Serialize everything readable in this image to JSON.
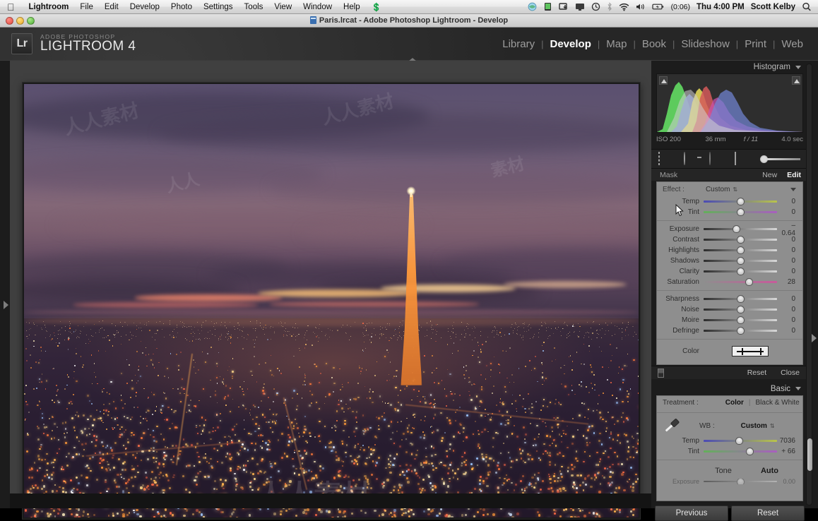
{
  "menubar": {
    "apple_icon": "apple-logo",
    "items": [
      "Lightroom",
      "File",
      "Edit",
      "Develop",
      "Photo",
      "Settings",
      "Tools",
      "View",
      "Window",
      "Help"
    ],
    "app_menu_bold": "Lightroom",
    "script_icon": "script-menu-icon",
    "status_icons": [
      "dropbox-icon",
      "display-icon",
      "eject-icon",
      "airplay-icon",
      "timemachine-icon",
      "bluetooth-icon",
      "wifi-icon",
      "volume-icon",
      "battery-icon"
    ],
    "battery_time": "(0:06)",
    "clock": "Thu 4:00 PM",
    "user": "Scott Kelby",
    "search_icon": "spotlight-search-icon"
  },
  "titlebar": {
    "title": "Paris.lrcat - Adobe Photoshop Lightroom - Develop",
    "close": "close-button",
    "minimize": "minimize-button",
    "zoom": "zoom-button"
  },
  "identity": {
    "badge": "Lr",
    "sub": "ADOBE PHOTOSHOP",
    "name": "LIGHTROOM 4"
  },
  "modules": {
    "items": [
      {
        "label": "Library",
        "active": false
      },
      {
        "label": "Develop",
        "active": true
      },
      {
        "label": "Map",
        "active": false
      },
      {
        "label": "Book",
        "active": false
      },
      {
        "label": "Slideshow",
        "active": false
      },
      {
        "label": "Print",
        "active": false
      },
      {
        "label": "Web",
        "active": false
      }
    ],
    "separator": "|"
  },
  "histogram": {
    "title": "Histogram",
    "exif": {
      "iso": "ISO 200",
      "focal": "36 mm",
      "aperture": "f / 11",
      "shutter": "4.0 sec"
    }
  },
  "tools": {
    "items": [
      "crop-overlay-tool",
      "spot-removal-tool",
      "red-eye-tool",
      "graduated-filter-tool",
      "adjustment-brush-tool"
    ],
    "selected": "adjustment-brush-tool"
  },
  "mask_row": {
    "label": "Mask",
    "new": "New",
    "edit": "Edit"
  },
  "brush_panel": {
    "effect_label": "Effect :",
    "effect_value": "Custom",
    "sliders": [
      {
        "name": "Temp",
        "value": "0",
        "pos": 50,
        "style": "tempg"
      },
      {
        "name": "Tint",
        "value": "0",
        "pos": 50,
        "style": "tintg"
      },
      {
        "name": "Exposure",
        "value": "– 0.64",
        "pos": 45,
        "style": "plain"
      },
      {
        "name": "Contrast",
        "value": "0",
        "pos": 50,
        "style": "plain"
      },
      {
        "name": "Highlights",
        "value": "0",
        "pos": 50,
        "style": "plain"
      },
      {
        "name": "Shadows",
        "value": "0",
        "pos": 50,
        "style": "plain"
      },
      {
        "name": "Clarity",
        "value": "0",
        "pos": 50,
        "style": "plain"
      },
      {
        "name": "Saturation",
        "value": "28",
        "pos": 62,
        "style": "satg"
      },
      {
        "name": "Sharpness",
        "value": "0",
        "pos": 50,
        "style": "plain"
      },
      {
        "name": "Noise",
        "value": "0",
        "pos": 50,
        "style": "plain"
      },
      {
        "name": "Moire",
        "value": "0",
        "pos": 50,
        "style": "plain"
      },
      {
        "name": "Defringe",
        "value": "0",
        "pos": 50,
        "style": "plain"
      }
    ],
    "color_label": "Color",
    "footer": {
      "reset": "Reset",
      "close": "Close",
      "switch": "panel-switch-icon"
    }
  },
  "basic_panel": {
    "title": "Basic",
    "treatment_label": "Treatment :",
    "treatment_color": "Color",
    "treatment_bw": "Black & White",
    "wb_label": "WB :",
    "wb_value": "Custom",
    "eyedropper": "white-balance-eyedropper",
    "sliders": [
      {
        "name": "Temp",
        "value": "7036",
        "pos": 49,
        "style": "tempg"
      },
      {
        "name": "Tint",
        "value": "+ 66",
        "pos": 63,
        "style": "tintg"
      }
    ],
    "tone_label": "Tone",
    "auto_label": "Auto"
  },
  "footer_buttons": {
    "previous": "Previous",
    "reset": "Reset"
  },
  "photo": {
    "subject": "Paris skyline at dusk with Eiffel Tower",
    "watermark": "人人素材"
  },
  "colors": {
    "panel_bg": "#1c1c1c",
    "slider_panel_bg": "#8e8e8e",
    "center_bg": "#404040",
    "accent_text": "#ffffff",
    "muted_text": "#9a9a9a"
  }
}
